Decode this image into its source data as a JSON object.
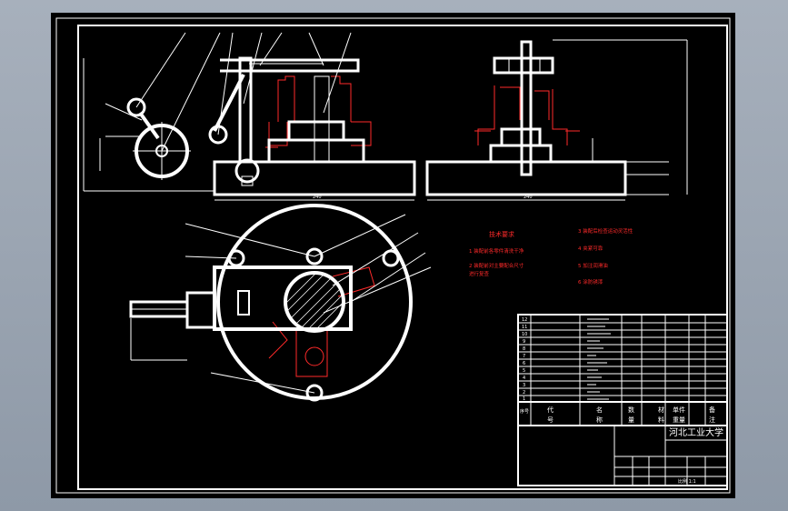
{
  "drawing": {
    "tech_req_title": "技术要求",
    "tech_req_left": [
      "1 装配前各零件清洗干净",
      "2 装配前对主要配合尺寸",
      "进行复查"
    ],
    "tech_req_right": [
      "3 装配后检查运动灵活性",
      "4 夹紧可靠",
      "5 加注润滑油",
      "6 涂防锈漆"
    ],
    "header_cells": {
      "code": "代",
      "code2": "号",
      "name": "名",
      "name2": "称",
      "qty": "数",
      "qty2": "量",
      "material": "材",
      "material2": "料",
      "weight": "单件",
      "weight2": "重量",
      "remark": "备",
      "remark2": "注",
      "seq": "序号"
    },
    "parts_rows": [
      "12",
      "11",
      "10",
      "9",
      "8",
      "7",
      "6",
      "5",
      "4",
      "3",
      "2",
      "1"
    ],
    "school": "河北工业大学",
    "scale_note": "比例 1:1",
    "dim_front_width": "240",
    "dim_side_width": "240"
  },
  "colors": {
    "line": "#ffffff",
    "hidden": "#ff2a2a",
    "background": "#000000",
    "frame_bg": "#9aa4b1"
  }
}
